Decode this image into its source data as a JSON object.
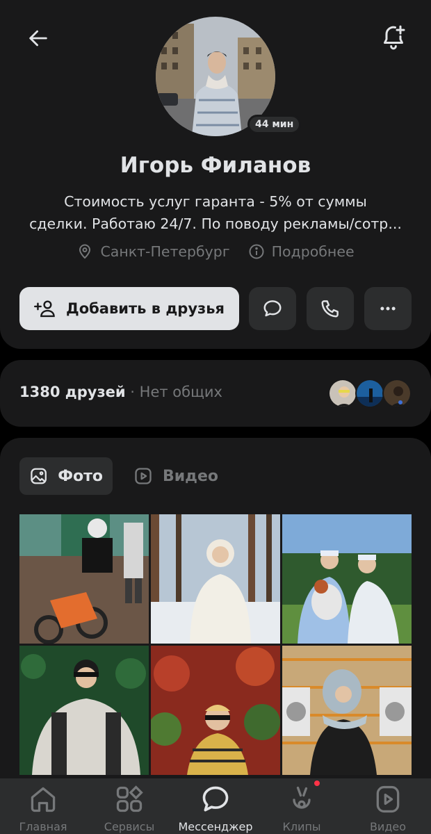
{
  "header": {
    "back_icon": "arrow-left-icon",
    "notify_icon": "bell-plus-icon"
  },
  "profile": {
    "name": "Игорь Филанов",
    "online": "44 мин",
    "status_line1": "Стоимость услуг гаранта - 5% от суммы",
    "status_line2": "сделки. Работаю 24/7. По поводу рекламы/сотр...",
    "city": "Санкт-Петербург",
    "details": "Подробнее"
  },
  "actions": {
    "add_friend": "Добавить в друзья",
    "message_icon": "message-bubble-icon",
    "call_icon": "phone-icon",
    "more_icon": "more-dots-icon"
  },
  "friends": {
    "count": "1380 друзей",
    "separator": "·",
    "mutual": "Нет общих"
  },
  "media": {
    "tabs": [
      {
        "label": "Фото",
        "active": true
      },
      {
        "label": "Видео",
        "active": false
      }
    ]
  },
  "tabbar": {
    "items": [
      {
        "label": "Главная",
        "icon": "home-icon"
      },
      {
        "label": "Сервисы",
        "icon": "services-grid-icon"
      },
      {
        "label": "Мессенджер",
        "icon": "messenger-icon",
        "active": true
      },
      {
        "label": "Клипы",
        "icon": "clips-icon",
        "badge": true
      },
      {
        "label": "Видео",
        "icon": "video-play-icon"
      }
    ]
  },
  "colors": {
    "background": "#000000",
    "card": "#19191a",
    "surface": "#2c2d2e",
    "text": "#e1e3e6",
    "muted": "#76787a",
    "badge": "#ff3347"
  }
}
